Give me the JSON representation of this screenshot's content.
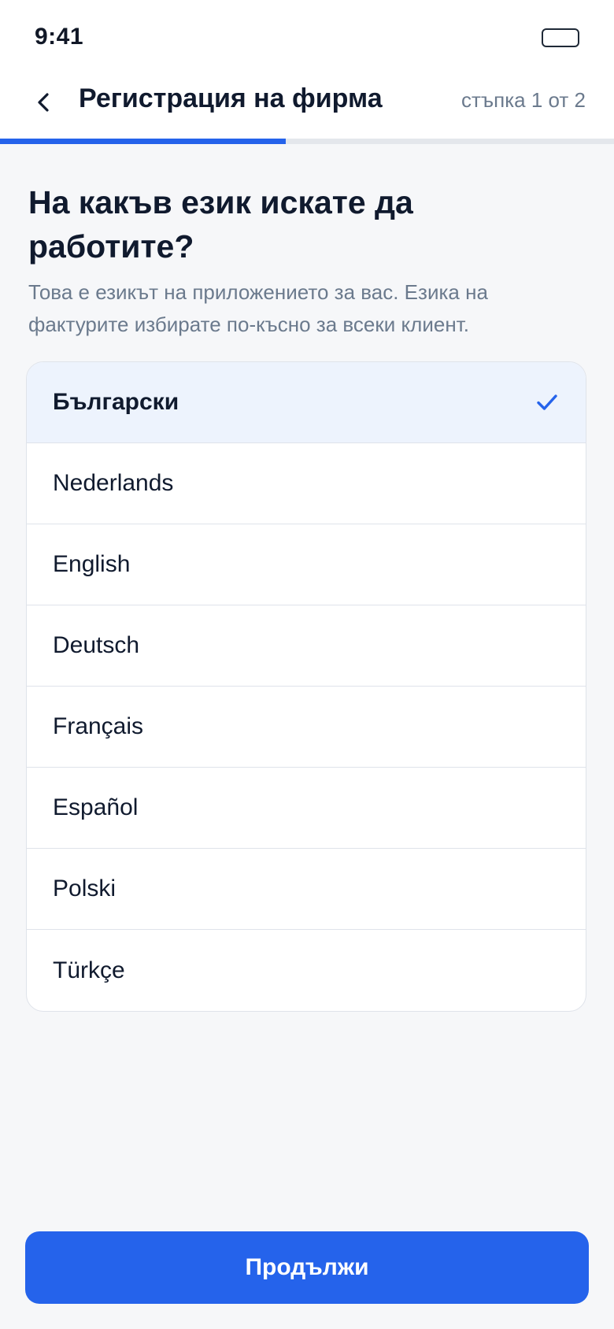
{
  "status_bar": {
    "time": "9:41"
  },
  "header": {
    "title": "Регистрация на фирма",
    "step": "стъпка 1 от 2",
    "back_icon": "chevron-left-icon"
  },
  "progress": {
    "fraction": 0.5,
    "color": "#2563eb"
  },
  "main": {
    "question": "На какъв език искате да работите?",
    "hint": "Това е езикът на приложението за вас. Езика на фактурите избирате по-късно за всеки клиент."
  },
  "languages": [
    {
      "label": "Български",
      "selected": true
    },
    {
      "label": "Nederlands",
      "selected": false
    },
    {
      "label": "English",
      "selected": false
    },
    {
      "label": "Deutsch",
      "selected": false
    },
    {
      "label": "Français",
      "selected": false
    },
    {
      "label": "Español",
      "selected": false
    },
    {
      "label": "Polski",
      "selected": false
    },
    {
      "label": "Türkçe",
      "selected": false
    }
  ],
  "selected_icon": "check-icon",
  "footer": {
    "continue_label": "Продължи"
  },
  "colors": {
    "accent": "#2563eb",
    "selected_row_bg": "#edf3fd",
    "background": "#f6f7f9"
  }
}
